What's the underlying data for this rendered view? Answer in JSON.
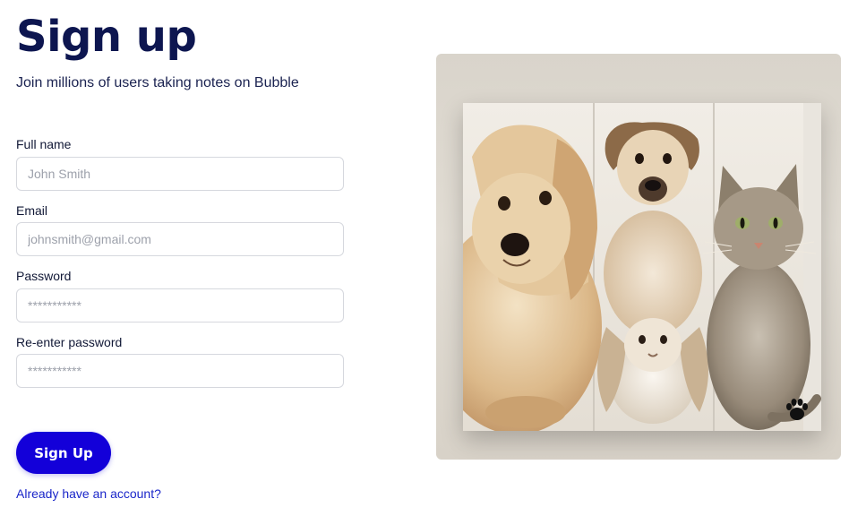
{
  "header": {
    "title": "Sign up",
    "subtitle": "Join millions of users taking notes on Bubble"
  },
  "form": {
    "full_name": {
      "label": "Full name",
      "placeholder": "John Smith"
    },
    "email": {
      "label": "Email",
      "placeholder": "johnsmith@gmail.com"
    },
    "password": {
      "label": "Password",
      "placeholder": "***********"
    },
    "reenter_password": {
      "label": "Re-enter password",
      "placeholder": "***********"
    },
    "submit_label": "Sign Up",
    "account_link": "Already have an account?"
  },
  "image": {
    "subject": "pets-collage-photo",
    "icon": "paw-icon"
  },
  "colors": {
    "primary": "#1300d9",
    "heading": "#0d1650",
    "link": "#1a26c9"
  }
}
